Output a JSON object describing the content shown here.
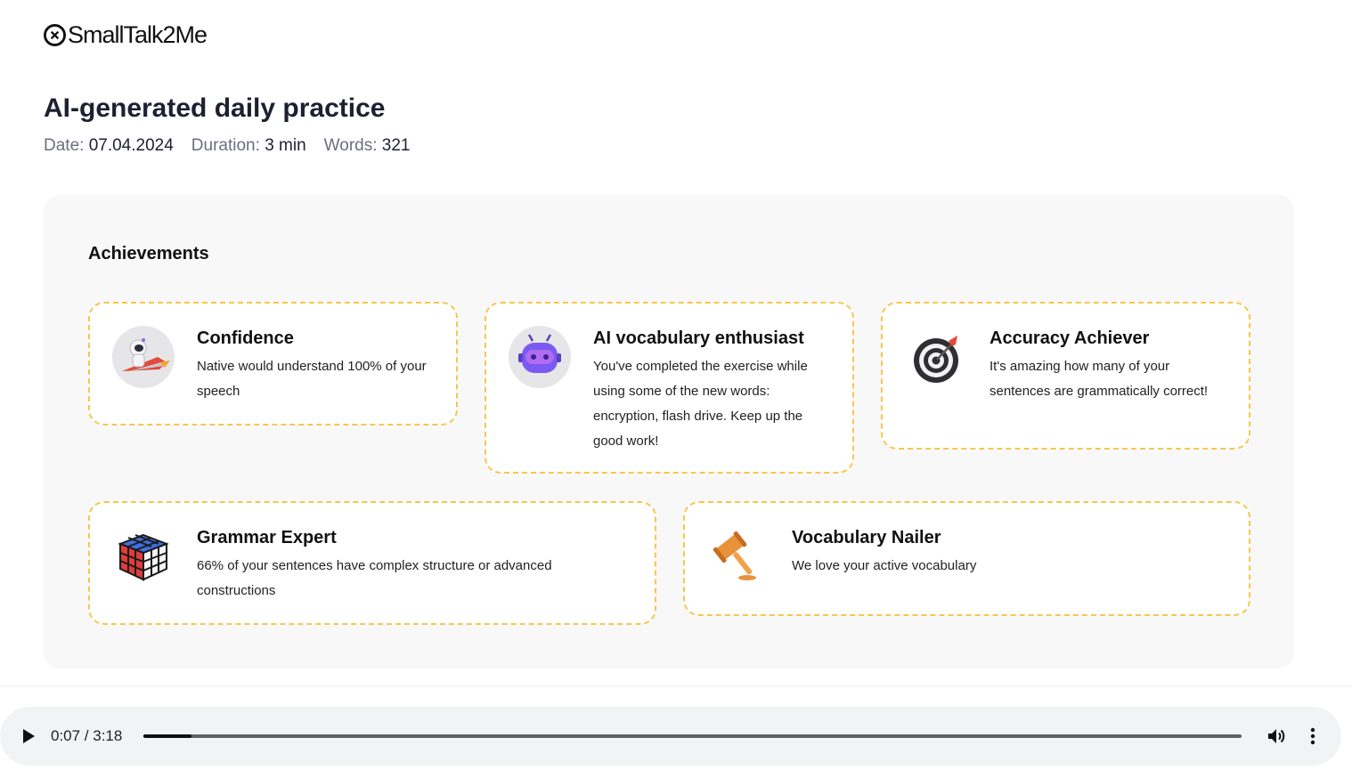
{
  "brand": {
    "name": "SmallTalk2Me"
  },
  "header": {
    "title": "AI-generated daily practice",
    "date_label": "Date:",
    "date_value": "07.04.2024",
    "duration_label": "Duration:",
    "duration_value": "3 min",
    "words_label": "Words:",
    "words_value": "321"
  },
  "achievements": {
    "title": "Achievements",
    "items": [
      {
        "icon": "rocket-astronaut-icon",
        "title": "Confidence",
        "description": "Native would understand 100% of your speech"
      },
      {
        "icon": "robot-icon",
        "title": "AI vocabulary enthusiast",
        "description": "You've completed the exercise while using some of the new words: encryption, flash drive. Keep up the good work!"
      },
      {
        "icon": "target-dart-icon",
        "title": "Accuracy Achiever",
        "description": "It's amazing how many of your sentences are grammatically correct!"
      },
      {
        "icon": "rubiks-cube-icon",
        "title": "Grammar Expert",
        "description": "66% of your sentences have complex structure or advanced constructions"
      },
      {
        "icon": "gavel-icon",
        "title": "Vocabulary Nailer",
        "description": "We love your active vocabulary"
      }
    ]
  },
  "player": {
    "current_time": "0:07",
    "total_time": "3:18",
    "time_display": "0:07 / 3:18",
    "progress_fraction": 0.044
  },
  "colors": {
    "card_border": "#f7c64f",
    "panel_bg": "#f8f8f8",
    "player_bg": "#f1f3f4"
  }
}
